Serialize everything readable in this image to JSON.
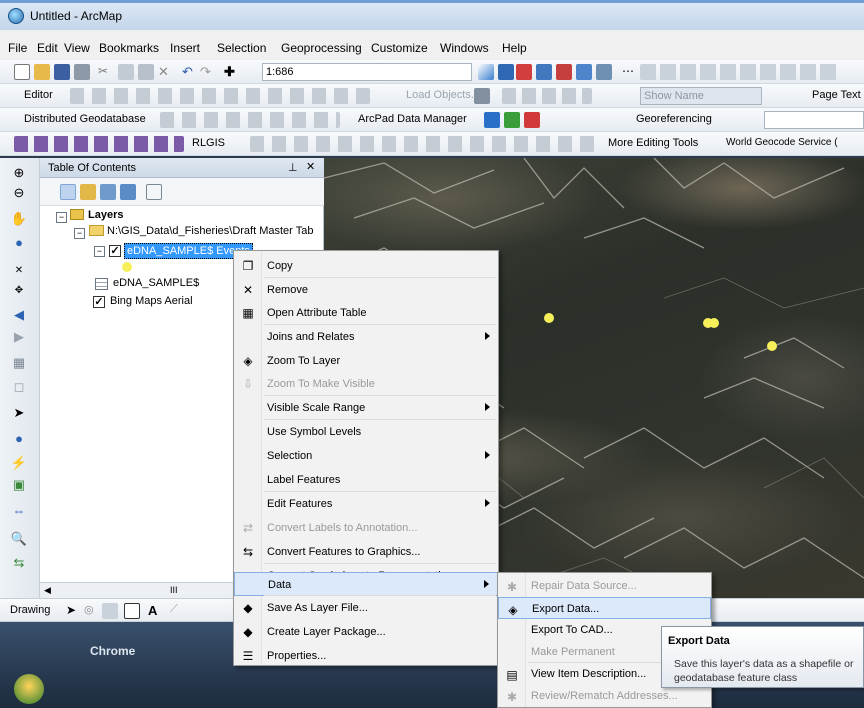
{
  "window": {
    "title": "Untitled - ArcMap"
  },
  "menubar": [
    "File",
    "Edit",
    "View",
    "Bookmarks",
    "Insert",
    "Selection",
    "Geoprocessing",
    "Customize",
    "Windows",
    "Help"
  ],
  "toolbar1": {
    "scale": "1:686"
  },
  "toolbar2": {
    "editor": "Editor",
    "load_objects": "Load Objects...",
    "show_name": "Show Name",
    "page_text": "Page Text"
  },
  "toolbar3": {
    "dist_geodb": "Distributed Geodatabase",
    "arcpad": "ArcPad Data Manager",
    "georef": "Georeferencing"
  },
  "toolbar4": {
    "rlgis": "RLGIS",
    "more_editing": "More Editing Tools",
    "world_geocode": "World Geocode Service ("
  },
  "toc": {
    "title": "Table Of Contents",
    "layers_label": "Layers",
    "folder_path": "N:\\GIS_Data\\d_Fisheries\\Draft Master Tab",
    "selected_layer": "eDNA_SAMPLE$ Events",
    "table_layer": "eDNA_SAMPLE$",
    "basemap_layer": "Bing Maps Aerial",
    "scroll_label": "III"
  },
  "drawbar": {
    "label": "Drawing"
  },
  "taskbar": {
    "chrome_label": "Chrome"
  },
  "context_menu": {
    "items": [
      {
        "label": "Copy",
        "icon": "copy-icon",
        "glyph": "❐",
        "disabled": false,
        "submenu": false
      },
      {
        "label": "Remove",
        "icon": "remove-icon",
        "glyph": "✕",
        "disabled": false,
        "submenu": false
      },
      {
        "label": "Open Attribute Table",
        "icon": "table-icon",
        "glyph": "▦",
        "disabled": false,
        "submenu": false
      },
      {
        "label": "Joins and Relates",
        "icon": "",
        "glyph": "",
        "disabled": false,
        "submenu": true
      },
      {
        "label": "Zoom To Layer",
        "icon": "zoom-layer-icon",
        "glyph": "◈",
        "disabled": false,
        "submenu": false
      },
      {
        "label": "Zoom To Make Visible",
        "icon": "zoom-visible-icon",
        "glyph": "⇩",
        "disabled": true,
        "submenu": false
      },
      {
        "label": "Visible Scale Range",
        "icon": "",
        "glyph": "",
        "disabled": false,
        "submenu": true
      },
      {
        "label": "Use Symbol Levels",
        "icon": "",
        "glyph": "",
        "disabled": false,
        "submenu": false
      },
      {
        "label": "Selection",
        "icon": "",
        "glyph": "",
        "disabled": false,
        "submenu": true
      },
      {
        "label": "Label Features",
        "icon": "",
        "glyph": "",
        "disabled": false,
        "submenu": false
      },
      {
        "label": "Edit Features",
        "icon": "",
        "glyph": "",
        "disabled": false,
        "submenu": true
      },
      {
        "label": "Convert Labels to Annotation...",
        "icon": "convert-labels-icon",
        "glyph": "⇄",
        "disabled": true,
        "submenu": false
      },
      {
        "label": "Convert Features to Graphics...",
        "icon": "convert-features-icon",
        "glyph": "⇆",
        "disabled": false,
        "submenu": false
      },
      {
        "label": "Convert Symbology to Representation...",
        "icon": "",
        "glyph": "",
        "disabled": false,
        "submenu": false
      },
      {
        "label": "Data",
        "icon": "",
        "glyph": "",
        "disabled": false,
        "submenu": true
      },
      {
        "label": "Save As Layer File...",
        "icon": "save-layer-icon",
        "glyph": "◆",
        "disabled": false,
        "submenu": false
      },
      {
        "label": "Create Layer Package...",
        "icon": "layer-package-icon",
        "glyph": "◆",
        "disabled": false,
        "submenu": false
      },
      {
        "label": "Properties...",
        "icon": "properties-icon",
        "glyph": "☰",
        "disabled": false,
        "submenu": false
      }
    ]
  },
  "data_submenu": {
    "items": [
      {
        "label": "Repair Data Source...",
        "icon": "repair-icon",
        "glyph": "✱",
        "disabled": true
      },
      {
        "label": "Export Data...",
        "icon": "export-icon",
        "glyph": "◈",
        "disabled": false
      },
      {
        "label": "Export To CAD...",
        "icon": "",
        "glyph": "",
        "disabled": false
      },
      {
        "label": "Make Permanent",
        "icon": "",
        "glyph": "",
        "disabled": true
      },
      {
        "label": "View Item Description...",
        "icon": "item-description-icon",
        "glyph": "▤",
        "disabled": false
      },
      {
        "label": "Review/Rematch Addresses...",
        "icon": "rematch-icon",
        "glyph": "✱",
        "disabled": true
      }
    ]
  },
  "tooltip": {
    "title": "Export Data",
    "body": "Save this layer's data as a shapefile or geodatabase feature class"
  },
  "colors": {
    "highlight": "#dbe9fa",
    "point_symbol": "#f6ef5a",
    "selected_layer_bg": "#3399ff"
  }
}
